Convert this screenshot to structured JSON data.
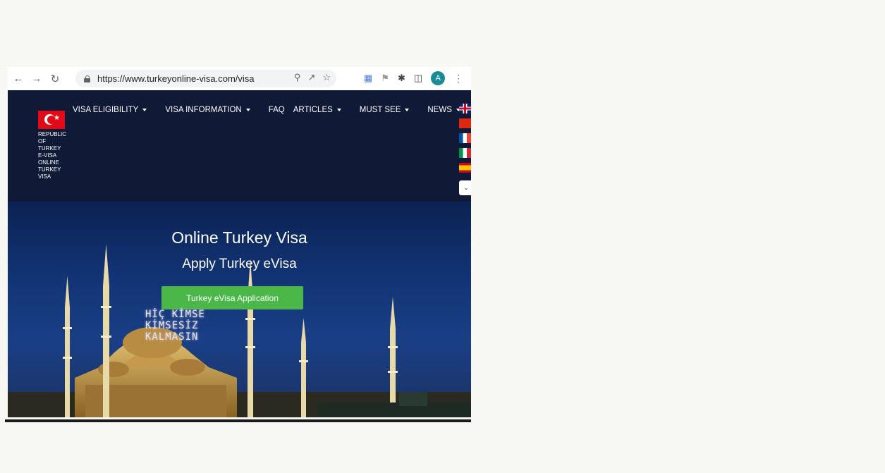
{
  "browser": {
    "url": "https://www.turkeyonline-visa.com/visa",
    "avatar_letter": "A",
    "icons": [
      "back-icon",
      "forward-icon",
      "reload-icon",
      "lock-icon",
      "zoom-icon",
      "share-icon",
      "bookmark-star-icon",
      "translate-icon",
      "flag-icon",
      "extensions-icon",
      "sidepanel-icon",
      "menu-kebab-icon"
    ]
  },
  "site": {
    "brand_lines": [
      "REPUBLIC",
      "OF",
      "TURKEY",
      "E-VISA",
      "ONLINE",
      "TURKEY",
      "VISA"
    ],
    "menu": [
      {
        "label": "VISA ELIGIBILITY",
        "dropdown": true
      },
      {
        "label": "VISA INFORMATION",
        "dropdown": true
      },
      {
        "label": "FAQ",
        "dropdown": false
      },
      {
        "label": "ARTICLES",
        "dropdown": true
      },
      {
        "label": "MUST SEE",
        "dropdown": true
      },
      {
        "label": "NEWS",
        "dropdown": true
      }
    ],
    "languages": [
      "english",
      "chinese",
      "french",
      "italian",
      "spanish"
    ]
  },
  "hero": {
    "title": "Online Turkey Visa",
    "subtitle": "Apply Turkey eVisa",
    "cta_label": "Turkey eVisa Application",
    "banner_lines": [
      "HİÇ KİMSE",
      "KİMSESİZ",
      "KALMASIN"
    ]
  },
  "colors": {
    "header_bg": "#101935",
    "cta_green": "#4cb749",
    "flag_red": "#e30a17"
  }
}
